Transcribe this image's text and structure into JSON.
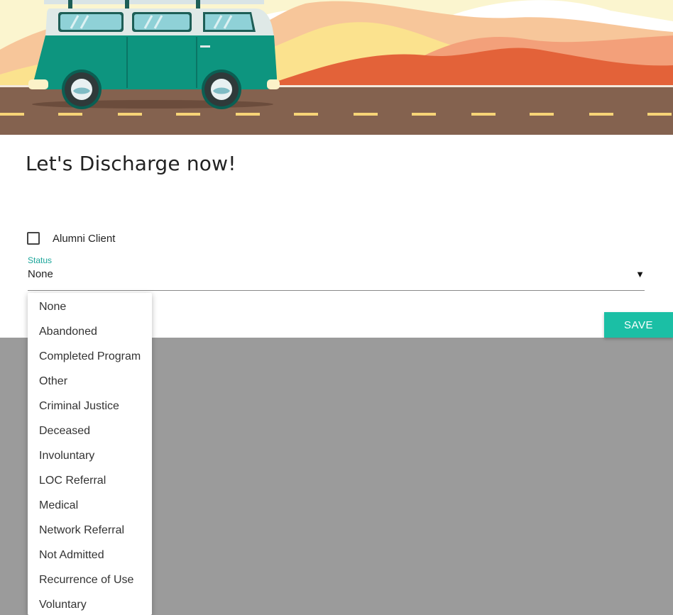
{
  "page": {
    "title": "Let's Discharge now!"
  },
  "form": {
    "alumni_label": "Alumni Client",
    "alumni_checked": false,
    "status_label": "Status",
    "status_value": "None",
    "save_label": "SAVE"
  },
  "status_options": [
    "None",
    "Abandoned",
    "Completed Program",
    "Other",
    "Criminal Justice",
    "Deceased",
    "Involuntary",
    "LOC Referral",
    "Medical",
    "Network Referral",
    "Not Admitted",
    "Recurrence of Use",
    "Voluntary"
  ],
  "colors": {
    "accent": "#1bbfa5",
    "label_accent": "#1ba59a",
    "overlay": "#9b9b9b",
    "van_body": "#0d957f",
    "road": "#84624f"
  },
  "icons": {
    "dropdown": "caret-down-icon",
    "hero": "camper-van-illustration"
  }
}
